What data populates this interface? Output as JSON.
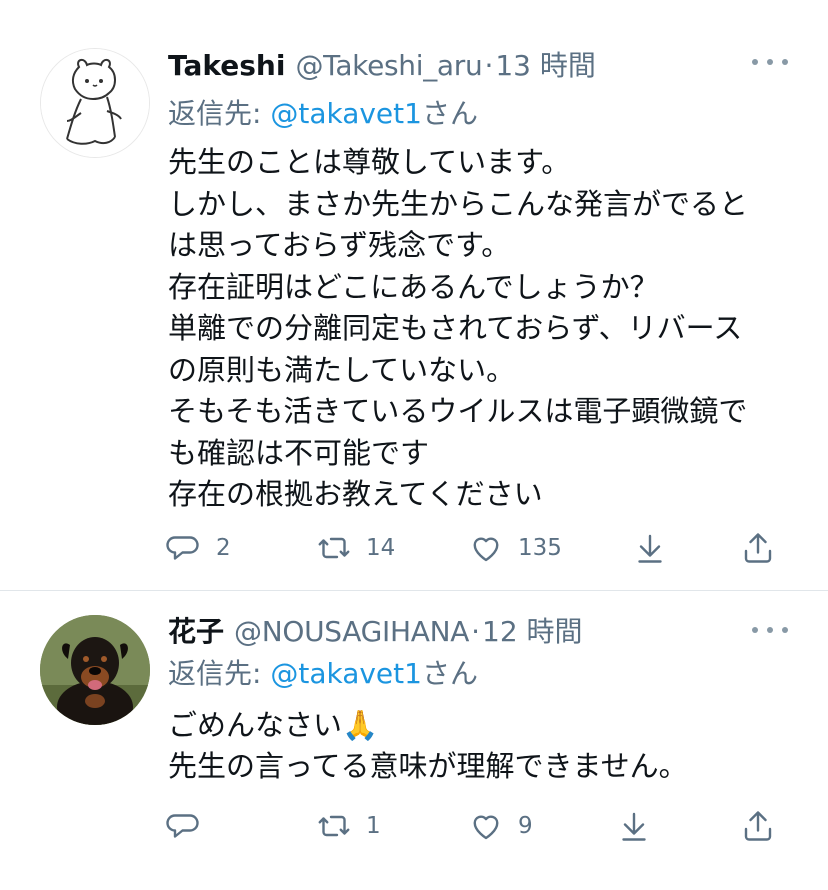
{
  "tweets": [
    {
      "name": "Takeshi",
      "handle": "@Takeshi_aru",
      "separator": "·",
      "time": "13 時間",
      "reply_label": "返信先: ",
      "reply_mention": "@takavet1",
      "reply_suffix": "さん",
      "lines": [
        "先生のことは尊敬しています。",
        "しかし、まさか先生からこんな発言がでると",
        "は思っておらず残念です。",
        "存在証明はどこにあるんでしょうか？",
        "単離での分離同定もされておらず、リバース",
        "の原則も満たしていない。",
        "そもそも活きているウイルスは電子顕微鏡で",
        "も確認は不可能です",
        "存在の根拠お教えてください"
      ],
      "replies": "2",
      "retweets": "14",
      "likes": "135",
      "avatar_icon": "white-creature-avatar"
    },
    {
      "name": "花子",
      "handle": "@NOUSAGIHANA",
      "separator": "·",
      "time": "12 時間",
      "reply_label": "返信先: ",
      "reply_mention": "@takavet1",
      "reply_suffix": "さん",
      "lines": [
        "ごめんなさい🙏",
        "先生の言ってる意味が理解できません。"
      ],
      "replies": "",
      "retweets": "1",
      "likes": "9",
      "avatar_icon": "dog-avatar"
    }
  ],
  "colors": {
    "text": "#0f1419",
    "secondary": "#5b7083",
    "link": "#1b95e0",
    "divider": "#e1e6ea"
  }
}
